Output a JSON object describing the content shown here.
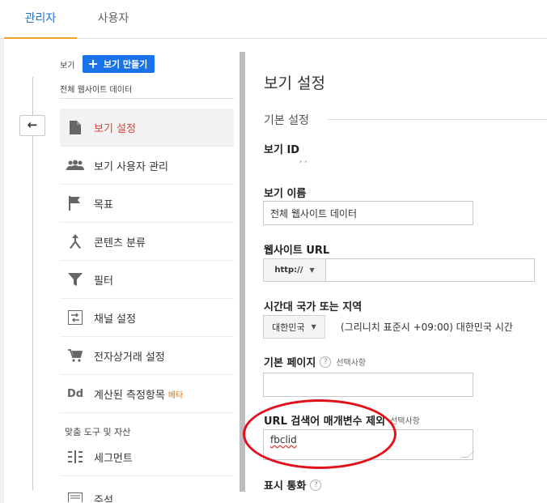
{
  "tabs": [
    {
      "label": "관리자",
      "active": true
    },
    {
      "label": "사용자",
      "active": false
    }
  ],
  "sidebar": {
    "view_label": "보기",
    "create_view_label": "보기 만들기",
    "view_name": "전체 웹사이트 데이터",
    "items": [
      {
        "label": "보기 설정",
        "icon": "document-icon",
        "active": true
      },
      {
        "label": "보기 사용자 관리",
        "icon": "people-icon"
      },
      {
        "label": "목표",
        "icon": "flag-icon"
      },
      {
        "label": "콘텐츠 분류",
        "icon": "content-grouping-icon"
      },
      {
        "label": "필터",
        "icon": "filter-icon"
      },
      {
        "label": "채널 설정",
        "icon": "channel-settings-icon"
      },
      {
        "label": "전자상거래 설정",
        "icon": "cart-icon"
      },
      {
        "label": "계산된 측정항목",
        "icon": "calculated-metrics-icon",
        "icon_text": "Dd",
        "badge": "베타"
      },
      {
        "label": "세그먼트",
        "icon": "segments-icon"
      }
    ],
    "section_title": "맞춤 도구 및 자산",
    "partial_item": "주석"
  },
  "content": {
    "title": "보기 설정",
    "section": "기본 설정",
    "view_id_label": "보기 ID",
    "view_id_value": ", ,",
    "view_name_label": "보기 이름",
    "view_name_value": "전체 웹사이트 데이터",
    "website_url_label": "웹사이트 URL",
    "url_protocol": "http://",
    "timezone_label": "시간대 국가 또는 지역",
    "country_value": "대한민국",
    "timezone_value": "(그리니치 표준시 +09:00) 대한민국 시간",
    "default_page_label": "기본 페이지",
    "optional_text": "선택사항",
    "help_glyph": "?",
    "exclude_params_label": "URL 검색어 매개변수 제외",
    "exclude_params_value": "fbclid",
    "currency_label": "표시 통화"
  },
  "colors": {
    "accent_blue": "#1a73e8",
    "active_red": "#db4437",
    "tab_underline": "#f4a224",
    "annotation_red": "#e3101a"
  }
}
